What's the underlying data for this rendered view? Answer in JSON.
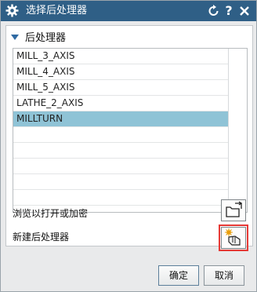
{
  "dialog": {
    "title": "选择后处理器"
  },
  "group": {
    "title": "后处理器"
  },
  "postprocessors": [
    {
      "name": "MILL_3_AXIS"
    },
    {
      "name": "MILL_4_AXIS"
    },
    {
      "name": "MILL_5_AXIS"
    },
    {
      "name": "LATHE_2_AXIS"
    },
    {
      "name": "MILLTURN"
    }
  ],
  "selected_index": 4,
  "actions": {
    "browse_label": "浏览以打开或加密",
    "new_label": "新建后处理器"
  },
  "footer": {
    "ok_label": "确定",
    "cancel_label": "取消"
  },
  "colors": {
    "titlebar": "#2f5f86",
    "selection": "#8fc3d6",
    "highlight": "#e53935"
  },
  "icons": {
    "title": "gear-icon",
    "reset": "reset-icon",
    "help": "help-icon",
    "close": "close-icon",
    "browse": "open-folder-icon",
    "new": "new-postprocessor-icon"
  }
}
